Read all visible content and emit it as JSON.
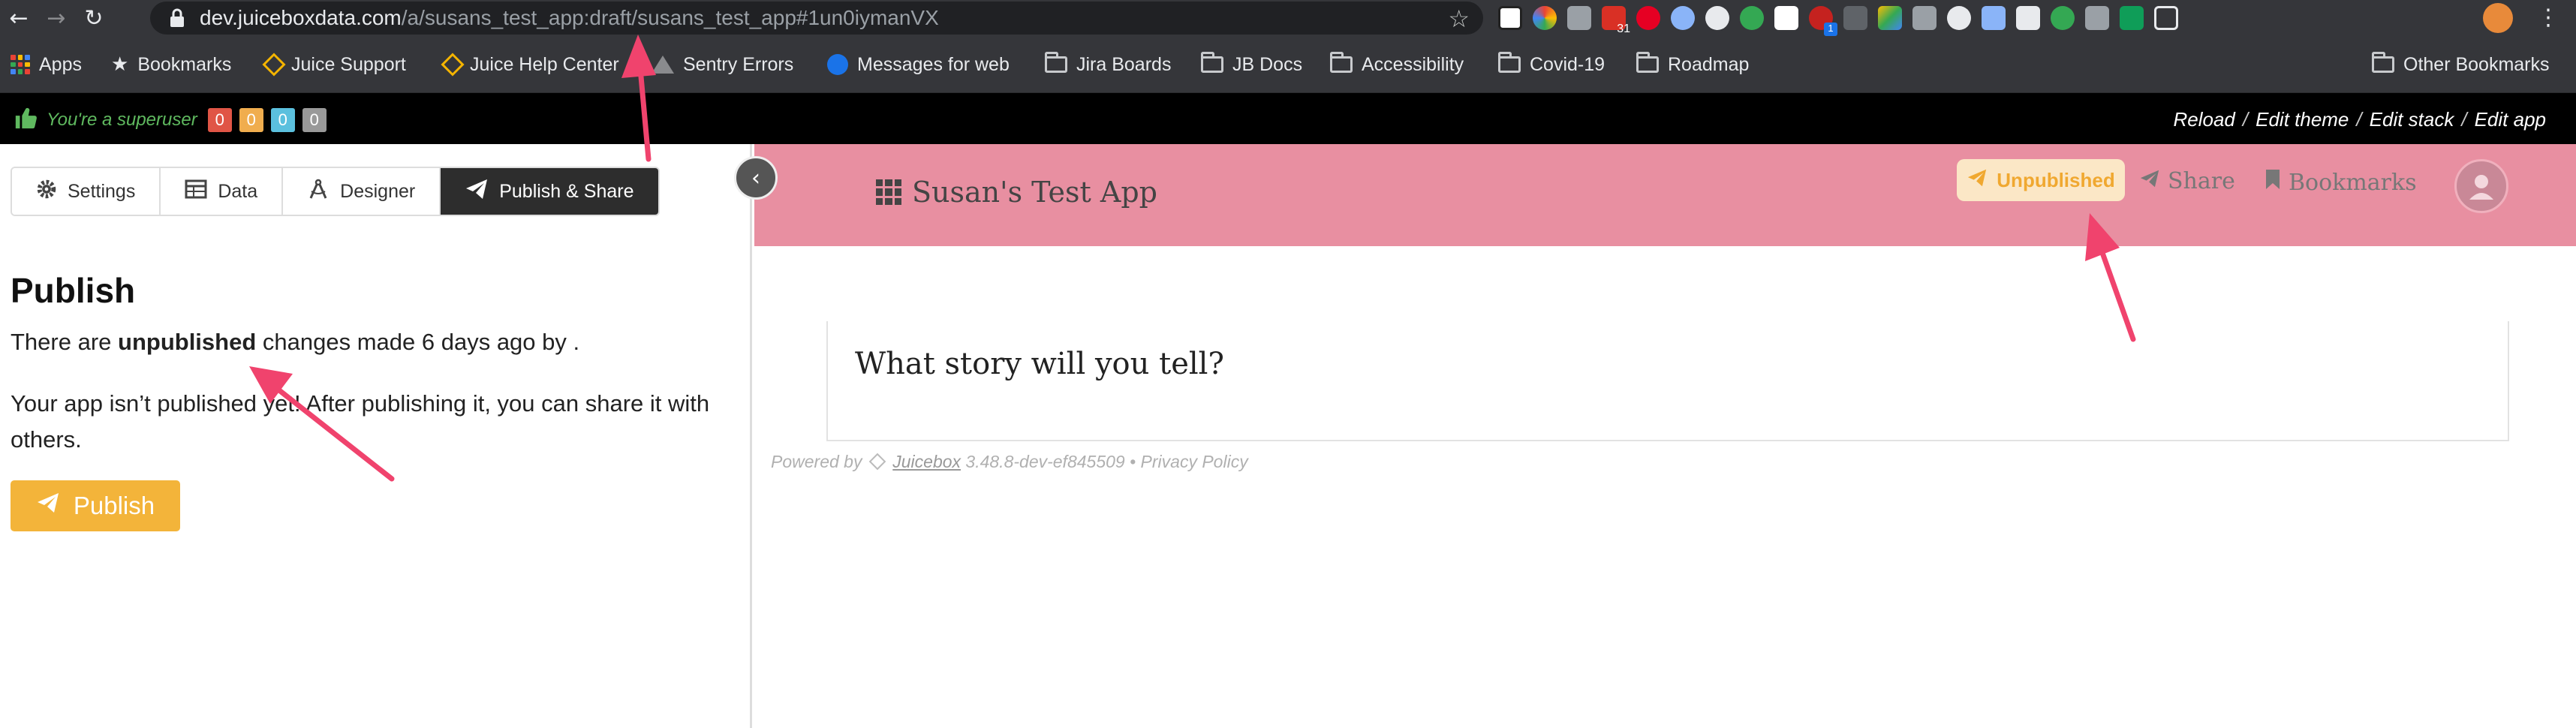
{
  "browser": {
    "url_host": "dev.juiceboxdata.com",
    "url_path": "/a/susans_test_app:draft/susans_test_app#1un0iymanVX",
    "bookmarks": [
      {
        "label": "Apps",
        "icon": "apps-grid-icon"
      },
      {
        "label": "Bookmarks",
        "icon": "star-icon"
      },
      {
        "label": "Juice Support",
        "icon": "juice-diamond-icon"
      },
      {
        "label": "Juice Help Center",
        "icon": "juice-diamond-icon"
      },
      {
        "label": "Sentry Errors",
        "icon": "sentry-icon"
      },
      {
        "label": "Messages for web",
        "icon": "messages-icon"
      },
      {
        "label": "Jira Boards",
        "icon": "folder-icon"
      },
      {
        "label": "JB Docs",
        "icon": "folder-icon"
      },
      {
        "label": "Accessibility",
        "icon": "folder-icon"
      },
      {
        "label": "Covid-19",
        "icon": "folder-icon"
      },
      {
        "label": "Roadmap",
        "icon": "folder-icon"
      }
    ],
    "other_bookmarks": "Other Bookmarks",
    "ext_calendar_badge": "31",
    "ext_notification_badge": "1"
  },
  "superuser": {
    "text": "You're a superuser",
    "badges": [
      {
        "value": "0",
        "color": "#e05546"
      },
      {
        "value": "0",
        "color": "#f0ad4e"
      },
      {
        "value": "0",
        "color": "#5bc0de"
      },
      {
        "value": "0",
        "color": "#999999"
      }
    ],
    "links": [
      "Reload",
      "Edit theme",
      "Edit stack",
      "Edit app"
    ],
    "separator": "/"
  },
  "editor": {
    "tabs": [
      {
        "label": "Settings",
        "icon": "gear-icon"
      },
      {
        "label": "Data",
        "icon": "table-icon"
      },
      {
        "label": "Designer",
        "icon": "compass-icon"
      },
      {
        "label": "Publish & Share",
        "icon": "paper-plane-icon",
        "active": true
      }
    ],
    "heading": "Publish",
    "status_prefix": "There are ",
    "status_bold": "unpublished",
    "status_suffix": " changes made 6 days ago by .",
    "info": "Your app isn’t published yet! After publishing it, you can share it with others.",
    "publish_button": "Publish"
  },
  "preview": {
    "app_title": "Susan's Test App",
    "unpublished_badge": "Unpublished",
    "share": "Share",
    "bookmarks": "Bookmarks",
    "story_prompt": "What story will you tell?",
    "footer": {
      "powered_by": "Powered by",
      "brand": "Juicebox",
      "version": "3.48.8-dev-ef845509",
      "bullet": "•",
      "privacy": "Privacy Policy"
    },
    "header_color": "#e88fa1"
  },
  "colors": {
    "accent_orange": "#f3b43a",
    "annotation_arrow": "#f0436d",
    "dark_tab": "#2d2d2d"
  }
}
